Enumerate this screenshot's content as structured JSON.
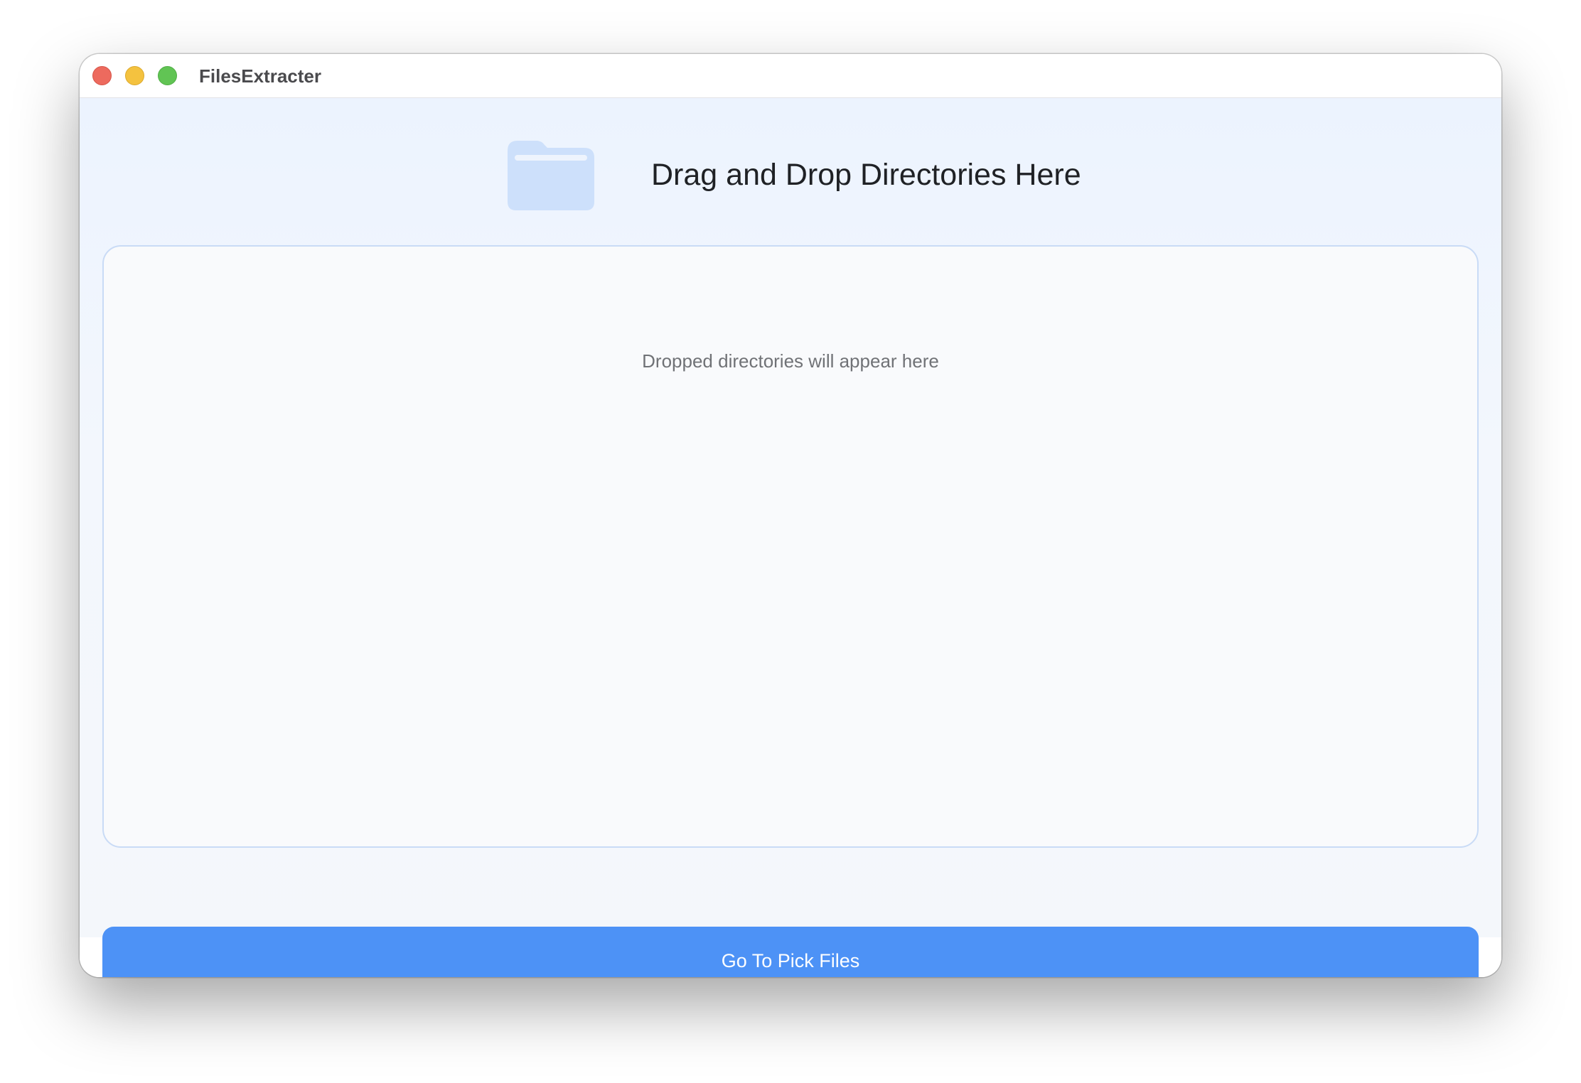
{
  "window": {
    "title": "FilesExtracter",
    "controls": {
      "close_icon": "close-icon",
      "minimize_icon": "minimize-icon",
      "maximize_icon": "maximize-icon"
    }
  },
  "header": {
    "icon": "folder-icon",
    "headline": "Drag and Drop Directories Here"
  },
  "drop_zone": {
    "placeholder": "Dropped directories will appear here"
  },
  "actions": {
    "pick_files_label": "Go To Pick Files"
  },
  "colors": {
    "accent": "#4d92f6",
    "folder": "#cde0fb",
    "drop_zone_border": "#c9dbf6",
    "traffic_close": "#ed6a5e",
    "traffic_minimize": "#f4c23f",
    "traffic_maximize": "#61c454"
  }
}
